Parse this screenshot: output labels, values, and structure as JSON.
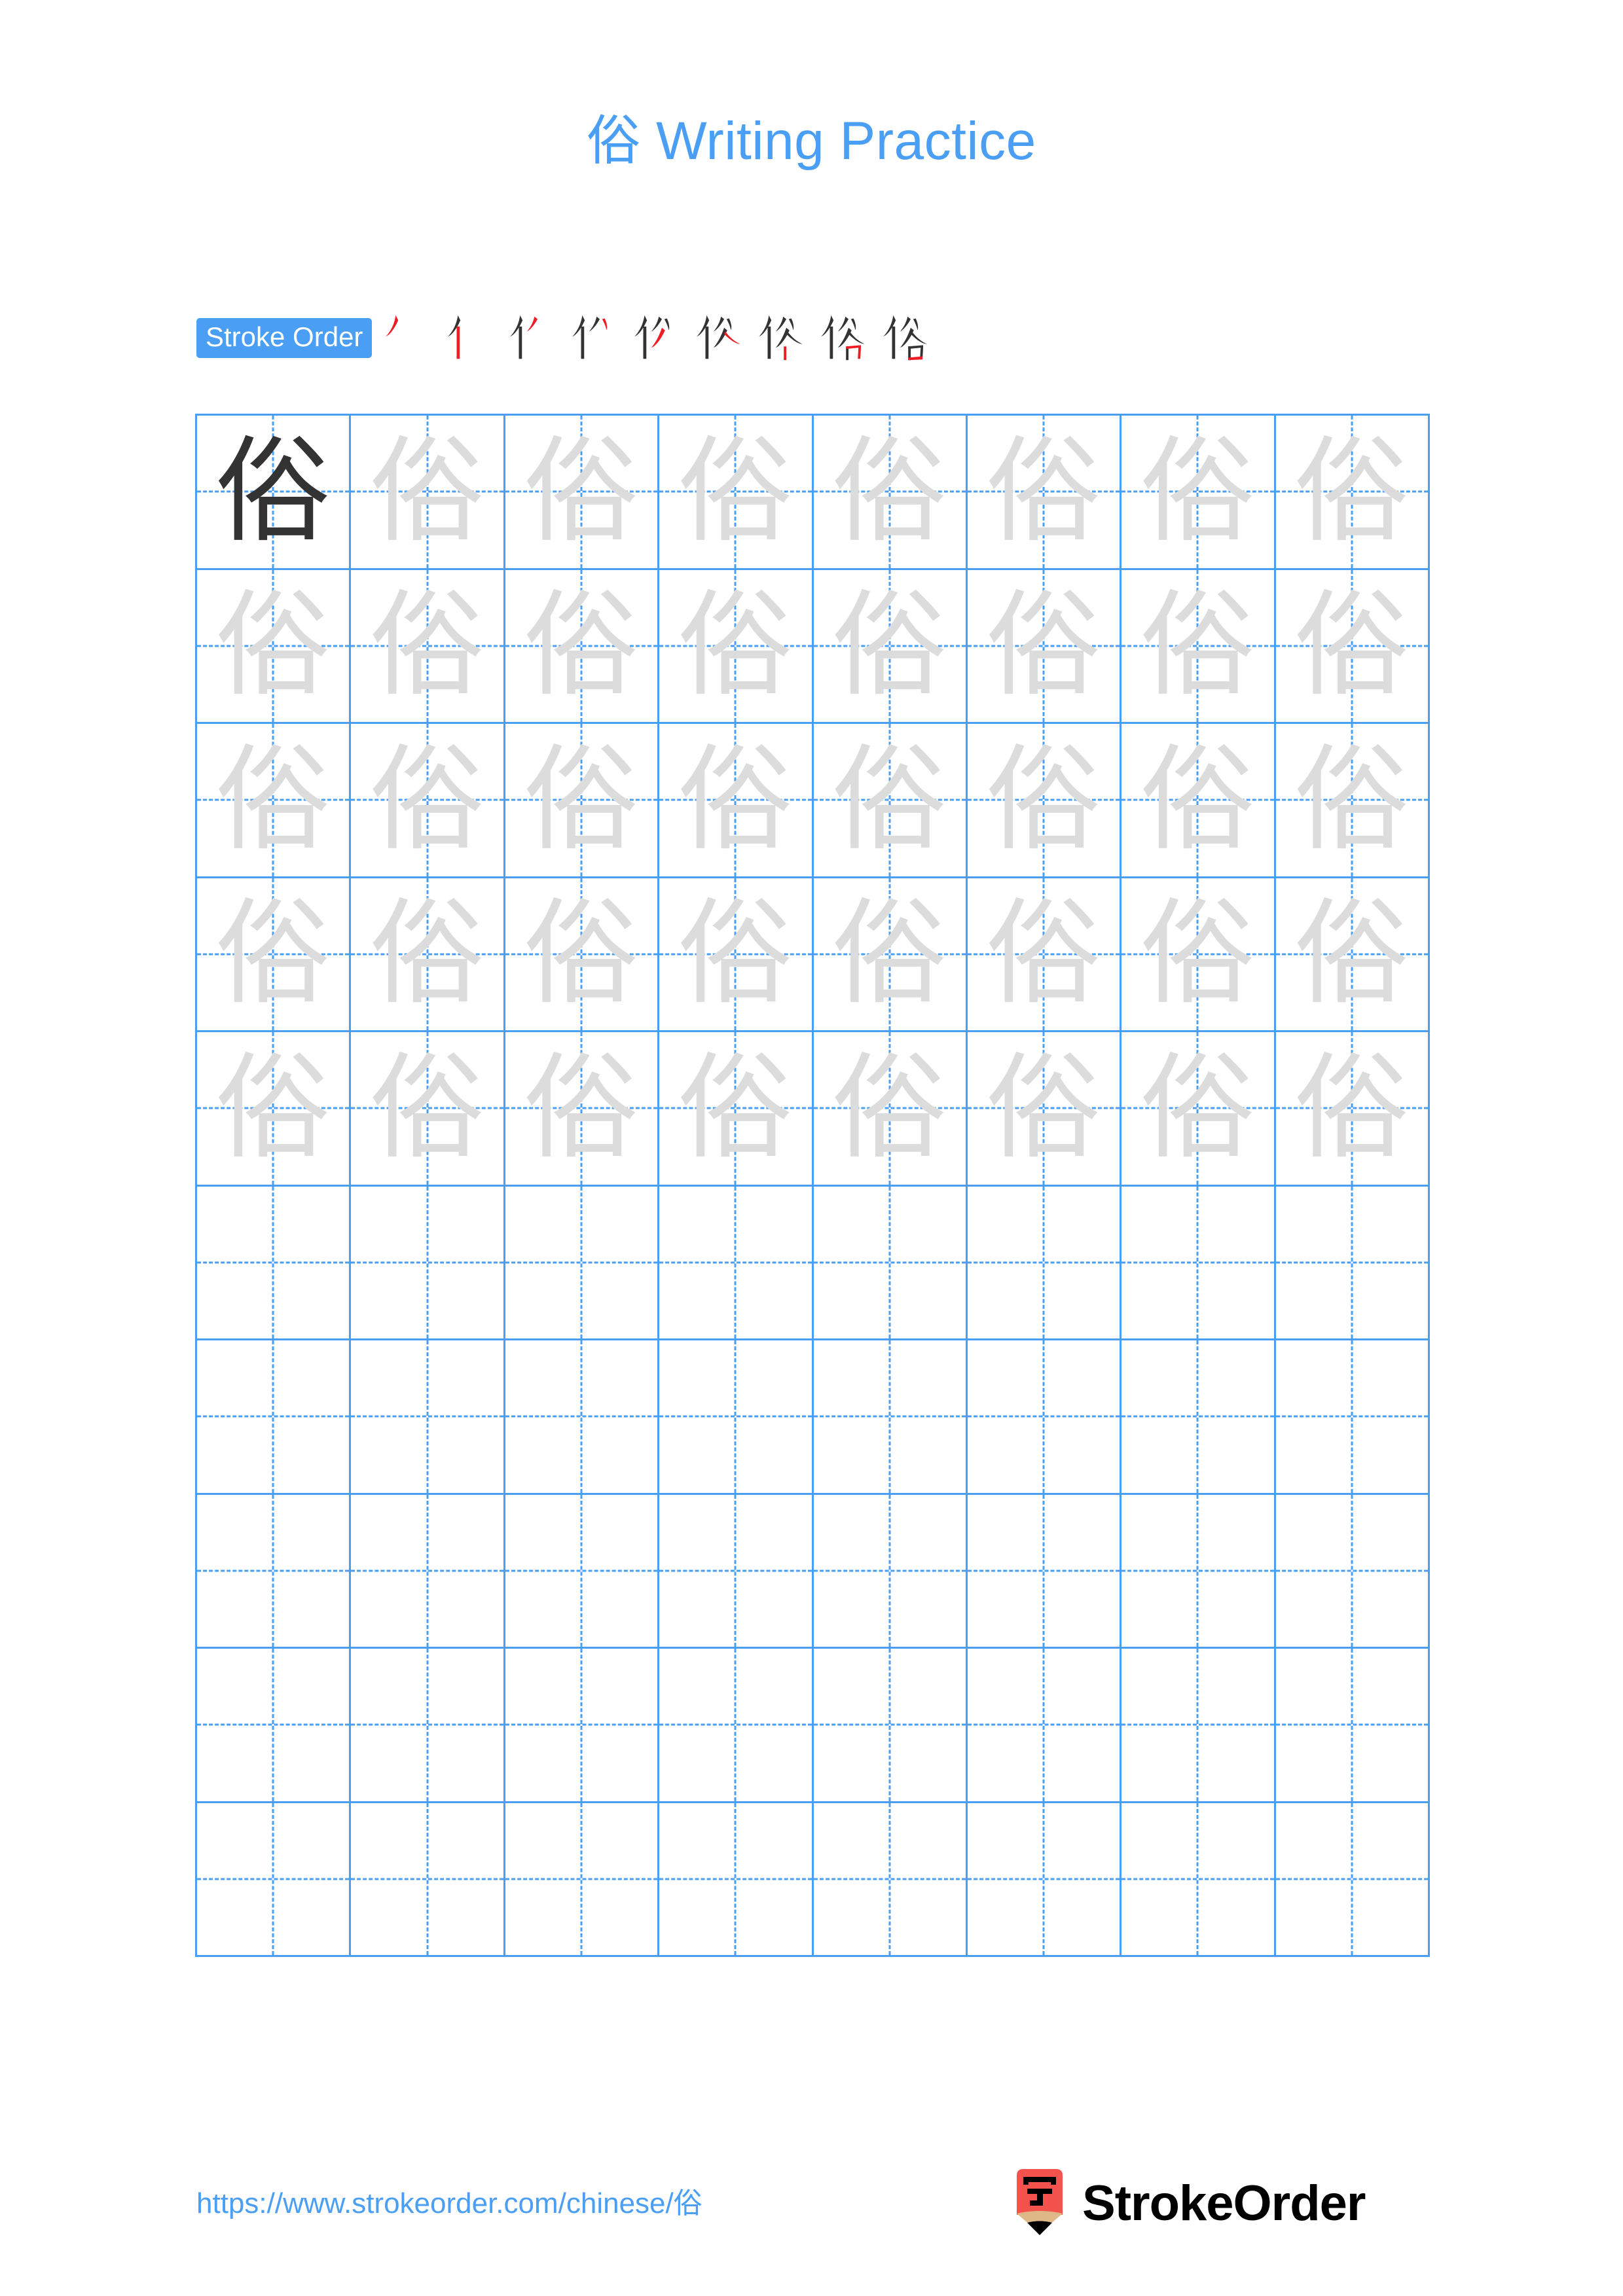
{
  "page": {
    "title_character": "俗",
    "title_text": "Writing Practice",
    "title_full": "俗 Writing Practice",
    "accent_color": "#4A9FF5",
    "trace_color": "#DCDCDC",
    "ink_color": "#333333",
    "stroke_highlight_color": "#EE1C25"
  },
  "stroke_order": {
    "label": "Stroke Order",
    "character": "俗",
    "total_strokes": 9,
    "steps": [
      {
        "index": 1,
        "strokes_shown": 1,
        "new_stroke": "丿 (piě)"
      },
      {
        "index": 2,
        "strokes_shown": 2,
        "new_stroke": "丨 (shù)"
      },
      {
        "index": 3,
        "strokes_shown": 3,
        "new_stroke": "丿 (piě)"
      },
      {
        "index": 4,
        "strokes_shown": 4,
        "new_stroke": "丶 (diǎn)"
      },
      {
        "index": 5,
        "strokes_shown": 5,
        "new_stroke": "丿 (piě)"
      },
      {
        "index": 6,
        "strokes_shown": 6,
        "new_stroke": "㇏ (nà)"
      },
      {
        "index": 7,
        "strokes_shown": 7,
        "new_stroke": "丨 (shù)"
      },
      {
        "index": 8,
        "strokes_shown": 8,
        "new_stroke": "𠃍 (héngzhé)"
      },
      {
        "index": 9,
        "strokes_shown": 9,
        "new_stroke": "一 (héng)"
      }
    ]
  },
  "practice_grid": {
    "columns": 8,
    "rows": 10,
    "cell_character": "俗",
    "rows_data": [
      {
        "row": 1,
        "cells": [
          "dark",
          "trace",
          "trace",
          "trace",
          "trace",
          "trace",
          "trace",
          "trace"
        ]
      },
      {
        "row": 2,
        "cells": [
          "trace",
          "trace",
          "trace",
          "trace",
          "trace",
          "trace",
          "trace",
          "trace"
        ]
      },
      {
        "row": 3,
        "cells": [
          "trace",
          "trace",
          "trace",
          "trace",
          "trace",
          "trace",
          "trace",
          "trace"
        ]
      },
      {
        "row": 4,
        "cells": [
          "trace",
          "trace",
          "trace",
          "trace",
          "trace",
          "trace",
          "trace",
          "trace"
        ]
      },
      {
        "row": 5,
        "cells": [
          "trace",
          "trace",
          "trace",
          "trace",
          "trace",
          "trace",
          "trace",
          "trace"
        ]
      },
      {
        "row": 6,
        "cells": [
          "empty",
          "empty",
          "empty",
          "empty",
          "empty",
          "empty",
          "empty",
          "empty"
        ]
      },
      {
        "row": 7,
        "cells": [
          "empty",
          "empty",
          "empty",
          "empty",
          "empty",
          "empty",
          "empty",
          "empty"
        ]
      },
      {
        "row": 8,
        "cells": [
          "empty",
          "empty",
          "empty",
          "empty",
          "empty",
          "empty",
          "empty",
          "empty"
        ]
      },
      {
        "row": 9,
        "cells": [
          "empty",
          "empty",
          "empty",
          "empty",
          "empty",
          "empty",
          "empty",
          "empty"
        ]
      },
      {
        "row": 10,
        "cells": [
          "empty",
          "empty",
          "empty",
          "empty",
          "empty",
          "empty",
          "empty",
          "empty"
        ]
      }
    ]
  },
  "footer": {
    "url": "https://www.strokeorder.com/chinese/俗",
    "brand_name": "StrokeOrder",
    "logo_character": "字",
    "logo_body_color": "#F4524D",
    "logo_wood_color": "#DEB887",
    "logo_tip_color": "#000000"
  }
}
